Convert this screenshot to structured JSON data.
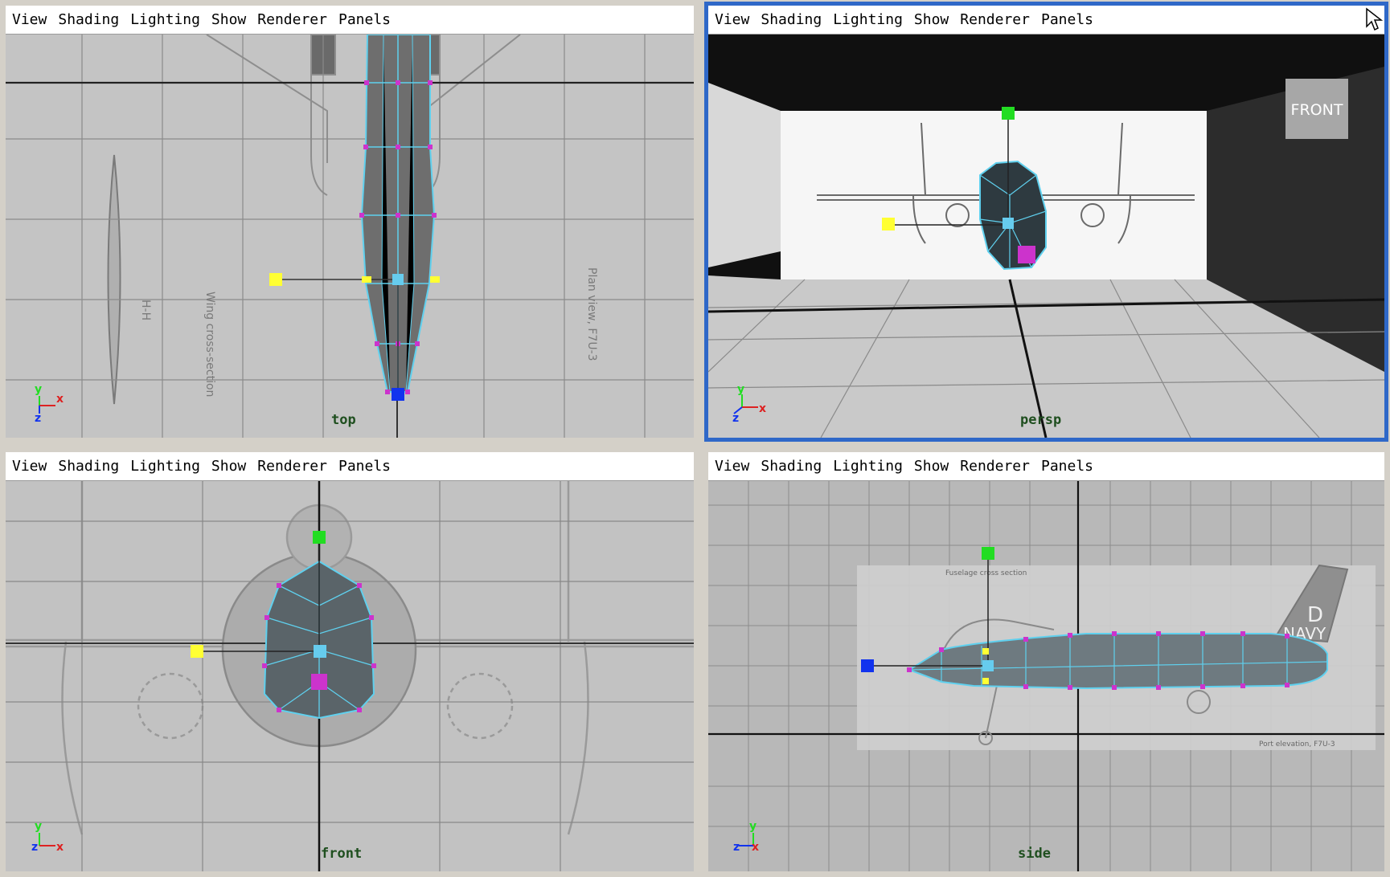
{
  "menu": [
    "View",
    "Shading",
    "Lighting",
    "Show",
    "Renderer",
    "Panels"
  ],
  "viewports": {
    "top": {
      "camera": "top",
      "active": false
    },
    "persp": {
      "camera": "persp",
      "active": true
    },
    "front": {
      "camera": "front",
      "active": false
    },
    "side": {
      "camera": "side",
      "active": false
    }
  },
  "image_planes": {
    "top_section_label": "H-H",
    "top_wing_label": "Wing cross-section",
    "top_plan_label": "Plan view, F7U-3",
    "persp_front_sign": "FRONT",
    "side_fuselage_label": "Fuselage cross section",
    "side_tail_letter": "D",
    "side_tail_text": "NAVY",
    "side_caption": "Port elevation, F7U-3"
  },
  "axes": {
    "x": "x",
    "y": "y",
    "z": "z"
  },
  "colors": {
    "active_border": "#2f68c8",
    "wire": "#5fd0ee",
    "vertex": "#cc33cc",
    "manip_yellow": "#ffff33",
    "manip_green": "#22dd22",
    "manip_blue": "#1133ee",
    "manip_cyan": "#66ccee"
  },
  "icons": [
    "axis-gizmo-icon",
    "mouse-cursor-icon"
  ]
}
